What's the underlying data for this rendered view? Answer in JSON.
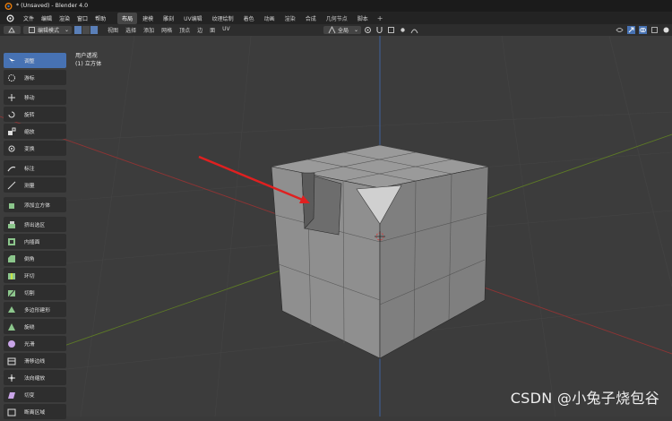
{
  "window": {
    "title": "* (Unsaved) - Blender 4.0"
  },
  "menubar": {
    "menus": [
      "文件",
      "编辑",
      "渲染",
      "窗口",
      "帮助"
    ],
    "workspaces": [
      "布局",
      "建模",
      "雕刻",
      "UV编辑",
      "纹理绘制",
      "着色",
      "动画",
      "渲染",
      "合成",
      "几何节点",
      "脚本"
    ],
    "active_workspace": "布局",
    "add_tab": "+"
  },
  "header": {
    "mode": "编辑模式",
    "menus": [
      "视图",
      "选择",
      "添加",
      "网格",
      "顶点",
      "边",
      "面",
      "UV"
    ],
    "orientation": "全局"
  },
  "viewport": {
    "view_name": "用户透视",
    "object_label": "(1) 立方体"
  },
  "toolbar": {
    "tools": [
      {
        "label": "调整",
        "icon": "select-box-icon",
        "active": true
      },
      {
        "label": "游标",
        "icon": "cursor-icon",
        "active": false
      },
      {
        "label": "移动",
        "icon": "move-icon",
        "active": false
      },
      {
        "label": "旋转",
        "icon": "rotate-icon",
        "active": false
      },
      {
        "label": "缩放",
        "icon": "scale-icon",
        "active": false
      },
      {
        "label": "变换",
        "icon": "transform-icon",
        "active": false
      },
      {
        "label": "标注",
        "icon": "annotate-icon",
        "active": false
      },
      {
        "label": "测量",
        "icon": "measure-icon",
        "active": false
      },
      {
        "label": "添加立方体",
        "icon": "add-cube-icon",
        "active": false
      },
      {
        "label": "挤出选区",
        "icon": "extrude-icon",
        "active": false
      },
      {
        "label": "内插面",
        "icon": "inset-icon",
        "active": false
      },
      {
        "label": "倒角",
        "icon": "bevel-icon",
        "active": false
      },
      {
        "label": "环切",
        "icon": "loop-cut-icon",
        "active": false
      },
      {
        "label": "切割",
        "icon": "knife-icon",
        "active": false
      },
      {
        "label": "多边形建形",
        "icon": "poly-build-icon",
        "active": false
      },
      {
        "label": "旋绕",
        "icon": "spin-icon",
        "active": false
      },
      {
        "label": "光滑",
        "icon": "smooth-icon",
        "active": false
      },
      {
        "label": "滑移边线",
        "icon": "edge-slide-icon",
        "active": false
      },
      {
        "label": "法向缩放",
        "icon": "shrink-fatten-icon",
        "active": false
      },
      {
        "label": "切变",
        "icon": "shear-icon",
        "active": false
      },
      {
        "label": "断离区域",
        "icon": "rip-region-icon",
        "active": false
      }
    ]
  },
  "watermark": "CSDN @小兔子烧包谷",
  "colors": {
    "accent": "#4772b3",
    "arrow": "#e02020",
    "x_axis": "#a03030",
    "y_axis": "#6b8a2a",
    "z_axis": "#3f66a8"
  }
}
